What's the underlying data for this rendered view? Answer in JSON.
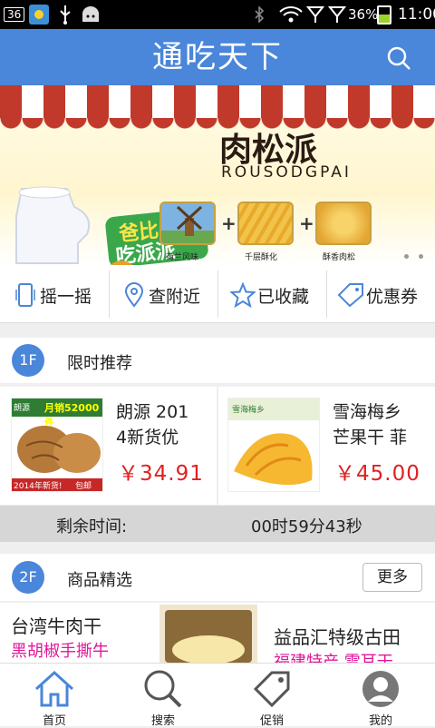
{
  "status_bar": {
    "badge": "36",
    "battery_text": "36%",
    "battery_level": "11",
    "time": "11:00",
    "icons": [
      "weather-icon",
      "usb-icon",
      "android-icon",
      "bluetooth-icon",
      "wifi-icon",
      "signal-icon",
      "signal-icon",
      "battery-icon"
    ]
  },
  "header": {
    "title": "通吃天下",
    "search_icon": "search-icon",
    "color": "#4a86d9"
  },
  "banner": {
    "tagline_top": "爸比",
    "tagline_bottom": "吃派派",
    "title": "肉松派",
    "subtitle": "ROUSODGPAI",
    "ingredients": [
      {
        "label": "荷兰风味"
      },
      {
        "label": "千层酥化"
      },
      {
        "label": "酥香肉松"
      }
    ],
    "plus": "+"
  },
  "quick_actions": [
    {
      "label": "摇一摇",
      "icon": "phone-shake-icon"
    },
    {
      "label": "查附近",
      "icon": "location-pin-icon"
    },
    {
      "label": "已收藏",
      "icon": "star-icon"
    },
    {
      "label": "优惠券",
      "icon": "coupon-tag-icon"
    }
  ],
  "floor1": {
    "badge": "1F",
    "title": "限时推荐",
    "products": [
      {
        "name_line1": "朗源 201",
        "name_line2": "4新货优",
        "price": "￥34.91",
        "image_text": {
          "brand": "朗源",
          "banner": "月销52000件",
          "year": "2014年新货!",
          "pack": "包邮"
        }
      },
      {
        "name_line1": "雪海梅乡",
        "name_line2": "芒果干 菲",
        "price": "￥45.00",
        "image_text": {
          "brand": "雪海梅乡"
        }
      }
    ],
    "countdown_label": "剩余时间:",
    "countdown_value": "00时59分43秒"
  },
  "floor2": {
    "badge": "2F",
    "title": "商品精选",
    "more": "更多",
    "products": [
      {
        "name_line1": "台湾牛肉干",
        "name_line2": "黑胡椒手撕牛"
      },
      {
        "name_line1": "益品汇特级古田",
        "name_line2": "福建特产 雪耳干"
      }
    ]
  },
  "tabs": [
    {
      "label": "首页",
      "icon": "home-icon"
    },
    {
      "label": "搜索",
      "icon": "search-icon"
    },
    {
      "label": "促销",
      "icon": "price-tag-icon"
    },
    {
      "label": "我的",
      "icon": "user-avatar-icon"
    }
  ],
  "colors": {
    "accent": "#4a86d9",
    "price": "#e02020",
    "promo_text": "#e0189a"
  }
}
